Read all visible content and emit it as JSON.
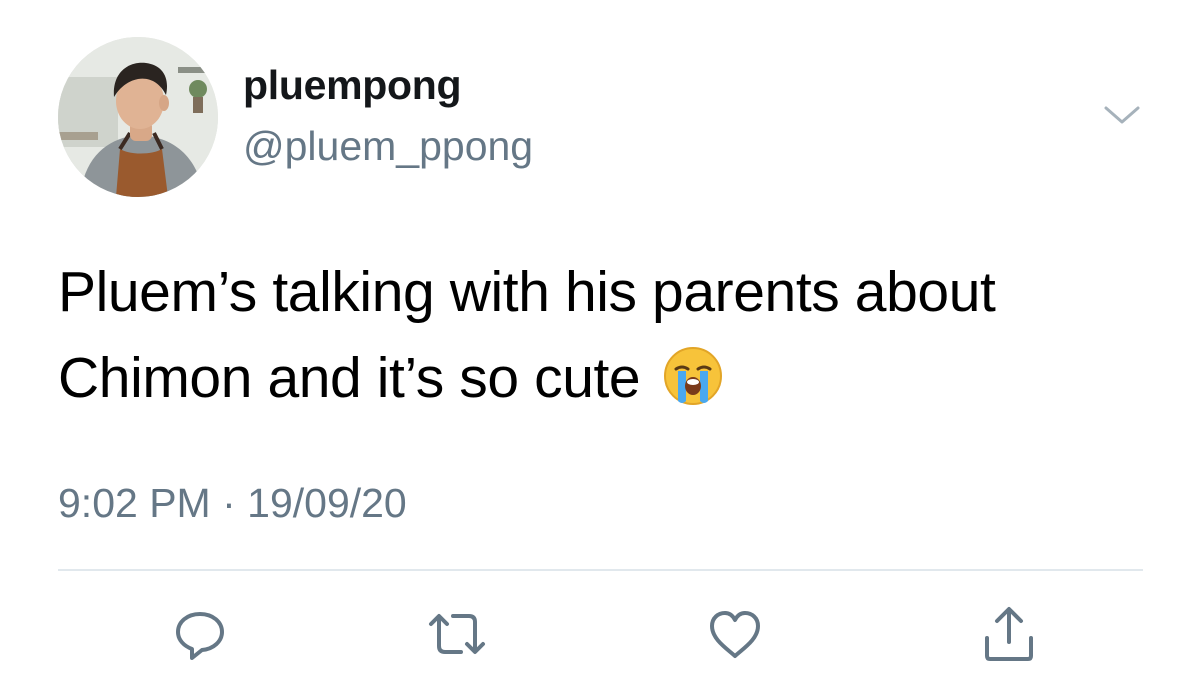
{
  "user": {
    "display_name": "pluempong",
    "handle": "@pluem_ppong"
  },
  "tweet": {
    "text": "Pluem’s talking with his parents about Chimon and it’s so cute",
    "emoji": "loudly-crying-face"
  },
  "meta": {
    "time": "9:02 PM",
    "separator": " · ",
    "date": "19/09/20"
  },
  "actions": {
    "reply_icon": "reply-icon",
    "retweet_icon": "retweet-icon",
    "like_icon": "heart-icon",
    "share_icon": "share-icon"
  },
  "colors": {
    "text": "#000000",
    "secondary": "#657786",
    "divider": "#e1e8ed",
    "icon": "#657786"
  }
}
